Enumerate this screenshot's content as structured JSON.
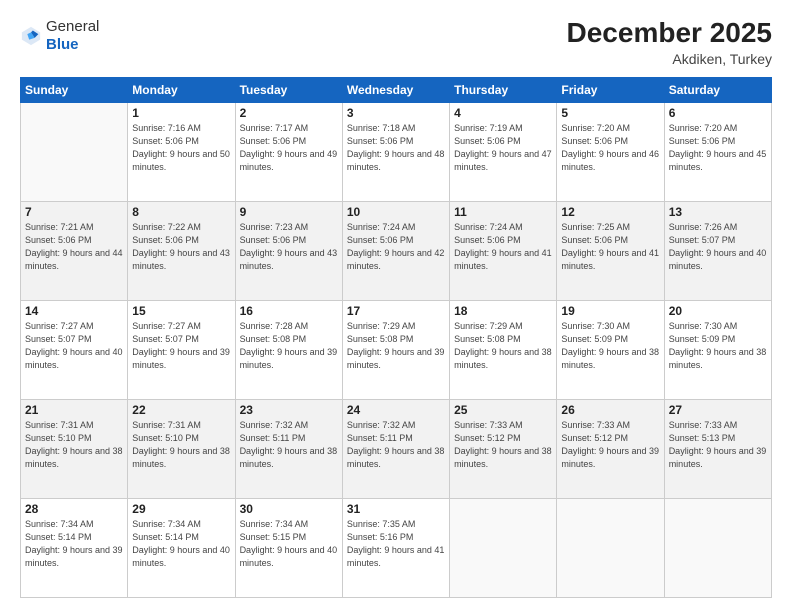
{
  "header": {
    "logo_general": "General",
    "logo_blue": "Blue",
    "month_year": "December 2025",
    "location": "Akdiken, Turkey"
  },
  "weekdays": [
    "Sunday",
    "Monday",
    "Tuesday",
    "Wednesday",
    "Thursday",
    "Friday",
    "Saturday"
  ],
  "rows": [
    {
      "shade": false,
      "cells": [
        {
          "day": "",
          "sunrise": "",
          "sunset": "",
          "daylight": ""
        },
        {
          "day": "1",
          "sunrise": "Sunrise: 7:16 AM",
          "sunset": "Sunset: 5:06 PM",
          "daylight": "Daylight: 9 hours and 50 minutes."
        },
        {
          "day": "2",
          "sunrise": "Sunrise: 7:17 AM",
          "sunset": "Sunset: 5:06 PM",
          "daylight": "Daylight: 9 hours and 49 minutes."
        },
        {
          "day": "3",
          "sunrise": "Sunrise: 7:18 AM",
          "sunset": "Sunset: 5:06 PM",
          "daylight": "Daylight: 9 hours and 48 minutes."
        },
        {
          "day": "4",
          "sunrise": "Sunrise: 7:19 AM",
          "sunset": "Sunset: 5:06 PM",
          "daylight": "Daylight: 9 hours and 47 minutes."
        },
        {
          "day": "5",
          "sunrise": "Sunrise: 7:20 AM",
          "sunset": "Sunset: 5:06 PM",
          "daylight": "Daylight: 9 hours and 46 minutes."
        },
        {
          "day": "6",
          "sunrise": "Sunrise: 7:20 AM",
          "sunset": "Sunset: 5:06 PM",
          "daylight": "Daylight: 9 hours and 45 minutes."
        }
      ]
    },
    {
      "shade": true,
      "cells": [
        {
          "day": "7",
          "sunrise": "Sunrise: 7:21 AM",
          "sunset": "Sunset: 5:06 PM",
          "daylight": "Daylight: 9 hours and 44 minutes."
        },
        {
          "day": "8",
          "sunrise": "Sunrise: 7:22 AM",
          "sunset": "Sunset: 5:06 PM",
          "daylight": "Daylight: 9 hours and 43 minutes."
        },
        {
          "day": "9",
          "sunrise": "Sunrise: 7:23 AM",
          "sunset": "Sunset: 5:06 PM",
          "daylight": "Daylight: 9 hours and 43 minutes."
        },
        {
          "day": "10",
          "sunrise": "Sunrise: 7:24 AM",
          "sunset": "Sunset: 5:06 PM",
          "daylight": "Daylight: 9 hours and 42 minutes."
        },
        {
          "day": "11",
          "sunrise": "Sunrise: 7:24 AM",
          "sunset": "Sunset: 5:06 PM",
          "daylight": "Daylight: 9 hours and 41 minutes."
        },
        {
          "day": "12",
          "sunrise": "Sunrise: 7:25 AM",
          "sunset": "Sunset: 5:06 PM",
          "daylight": "Daylight: 9 hours and 41 minutes."
        },
        {
          "day": "13",
          "sunrise": "Sunrise: 7:26 AM",
          "sunset": "Sunset: 5:07 PM",
          "daylight": "Daylight: 9 hours and 40 minutes."
        }
      ]
    },
    {
      "shade": false,
      "cells": [
        {
          "day": "14",
          "sunrise": "Sunrise: 7:27 AM",
          "sunset": "Sunset: 5:07 PM",
          "daylight": "Daylight: 9 hours and 40 minutes."
        },
        {
          "day": "15",
          "sunrise": "Sunrise: 7:27 AM",
          "sunset": "Sunset: 5:07 PM",
          "daylight": "Daylight: 9 hours and 39 minutes."
        },
        {
          "day": "16",
          "sunrise": "Sunrise: 7:28 AM",
          "sunset": "Sunset: 5:08 PM",
          "daylight": "Daylight: 9 hours and 39 minutes."
        },
        {
          "day": "17",
          "sunrise": "Sunrise: 7:29 AM",
          "sunset": "Sunset: 5:08 PM",
          "daylight": "Daylight: 9 hours and 39 minutes."
        },
        {
          "day": "18",
          "sunrise": "Sunrise: 7:29 AM",
          "sunset": "Sunset: 5:08 PM",
          "daylight": "Daylight: 9 hours and 38 minutes."
        },
        {
          "day": "19",
          "sunrise": "Sunrise: 7:30 AM",
          "sunset": "Sunset: 5:09 PM",
          "daylight": "Daylight: 9 hours and 38 minutes."
        },
        {
          "day": "20",
          "sunrise": "Sunrise: 7:30 AM",
          "sunset": "Sunset: 5:09 PM",
          "daylight": "Daylight: 9 hours and 38 minutes."
        }
      ]
    },
    {
      "shade": true,
      "cells": [
        {
          "day": "21",
          "sunrise": "Sunrise: 7:31 AM",
          "sunset": "Sunset: 5:10 PM",
          "daylight": "Daylight: 9 hours and 38 minutes."
        },
        {
          "day": "22",
          "sunrise": "Sunrise: 7:31 AM",
          "sunset": "Sunset: 5:10 PM",
          "daylight": "Daylight: 9 hours and 38 minutes."
        },
        {
          "day": "23",
          "sunrise": "Sunrise: 7:32 AM",
          "sunset": "Sunset: 5:11 PM",
          "daylight": "Daylight: 9 hours and 38 minutes."
        },
        {
          "day": "24",
          "sunrise": "Sunrise: 7:32 AM",
          "sunset": "Sunset: 5:11 PM",
          "daylight": "Daylight: 9 hours and 38 minutes."
        },
        {
          "day": "25",
          "sunrise": "Sunrise: 7:33 AM",
          "sunset": "Sunset: 5:12 PM",
          "daylight": "Daylight: 9 hours and 38 minutes."
        },
        {
          "day": "26",
          "sunrise": "Sunrise: 7:33 AM",
          "sunset": "Sunset: 5:12 PM",
          "daylight": "Daylight: 9 hours and 39 minutes."
        },
        {
          "day": "27",
          "sunrise": "Sunrise: 7:33 AM",
          "sunset": "Sunset: 5:13 PM",
          "daylight": "Daylight: 9 hours and 39 minutes."
        }
      ]
    },
    {
      "shade": false,
      "cells": [
        {
          "day": "28",
          "sunrise": "Sunrise: 7:34 AM",
          "sunset": "Sunset: 5:14 PM",
          "daylight": "Daylight: 9 hours and 39 minutes."
        },
        {
          "day": "29",
          "sunrise": "Sunrise: 7:34 AM",
          "sunset": "Sunset: 5:14 PM",
          "daylight": "Daylight: 9 hours and 40 minutes."
        },
        {
          "day": "30",
          "sunrise": "Sunrise: 7:34 AM",
          "sunset": "Sunset: 5:15 PM",
          "daylight": "Daylight: 9 hours and 40 minutes."
        },
        {
          "day": "31",
          "sunrise": "Sunrise: 7:35 AM",
          "sunset": "Sunset: 5:16 PM",
          "daylight": "Daylight: 9 hours and 41 minutes."
        },
        {
          "day": "",
          "sunrise": "",
          "sunset": "",
          "daylight": ""
        },
        {
          "day": "",
          "sunrise": "",
          "sunset": "",
          "daylight": ""
        },
        {
          "day": "",
          "sunrise": "",
          "sunset": "",
          "daylight": ""
        }
      ]
    }
  ]
}
